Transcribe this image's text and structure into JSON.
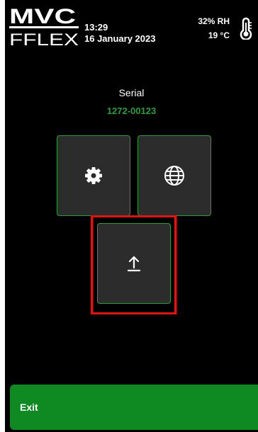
{
  "header": {
    "logo_text_top": "MVC",
    "logo_text_bottom": "FFLEX",
    "time": "13:29",
    "date": "16 January 2023",
    "humidity": "32% RH",
    "temperature": "19 °C",
    "thermometer_icon": "thermometer-icon"
  },
  "device": {
    "serial_label": "Serial",
    "serial_value": "1272-00123"
  },
  "tiles": [
    {
      "name": "settings",
      "icon": "gear-icon"
    },
    {
      "name": "network",
      "icon": "globe-icon"
    },
    {
      "name": "upload",
      "icon": "upload-icon"
    }
  ],
  "footer": {
    "exit_label": "Exit"
  },
  "colors": {
    "background": "#000000",
    "accent_green": "#2e9e3c",
    "exit_green": "#0f8a23",
    "tile_bg": "#2c2c2c",
    "highlight_red": "#e11414"
  }
}
